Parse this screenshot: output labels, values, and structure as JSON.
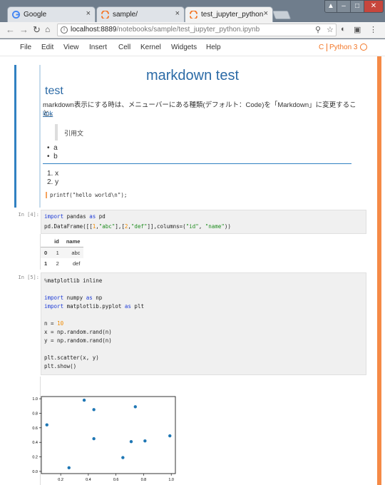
{
  "browser": {
    "tabs": [
      {
        "title": "Google",
        "close": "×"
      },
      {
        "title": "sample/",
        "close": "×"
      },
      {
        "title": "test_jupyter_python",
        "close": "×"
      }
    ],
    "address": {
      "host": "localhost:8889",
      "path": "/notebooks/sample/test_jupyter_python.ipynb"
    }
  },
  "menubar": {
    "items": [
      "File",
      "Edit",
      "View",
      "Insert",
      "Cell",
      "Kernel",
      "Widgets",
      "Help"
    ],
    "kernel_status": "C",
    "kernel_name": "Python 3"
  },
  "markdown": {
    "title": "markdown test",
    "h2": "test",
    "paragraph": "markdown表示にする時は、メニューバーにある種類(デフォルト：Code)を「Markdown」に変更すること。",
    "link": "link",
    "quote": "引用文",
    "bullets": [
      "a",
      "b"
    ],
    "ordered": [
      "x",
      "y"
    ],
    "code": "printf(\"hello world\\n\");"
  },
  "cell1": {
    "prompt": "In [4]:",
    "lines": [
      "import pandas as pd",
      "pd.DataFrame([[1,\"abc\"],[2,\"def\"]],columns=(\"id\", \"name\"))"
    ],
    "table": {
      "columns": [
        "",
        "id",
        "name"
      ],
      "rows": [
        [
          "0",
          "1",
          "abc"
        ],
        [
          "1",
          "2",
          "def"
        ]
      ]
    }
  },
  "cell2": {
    "prompt": "In [5]:",
    "lines": [
      "%matplotlib inline",
      "",
      "import numpy as np",
      "import matplotlib.pyplot as plt",
      "",
      "n = 10",
      "x = np.random.rand(n)",
      "y = np.random.rand(n)",
      "",
      "plt.scatter(x, y)",
      "plt.show()"
    ]
  },
  "chart_data": {
    "type": "scatter",
    "x": [
      0.1,
      0.26,
      0.37,
      0.44,
      0.44,
      0.65,
      0.71,
      0.74,
      0.81,
      0.99
    ],
    "y": [
      0.64,
      0.05,
      0.98,
      0.85,
      0.45,
      0.19,
      0.41,
      0.89,
      0.42,
      0.49
    ],
    "xticks": [
      "0.2",
      "0.4",
      "0.6",
      "0.8",
      "1.0"
    ],
    "yticks": [
      "0.0",
      "0.2",
      "0.4",
      "0.6",
      "0.8",
      "1.0"
    ],
    "xlim": [
      0.06,
      1.03
    ],
    "ylim": [
      -0.03,
      1.03
    ],
    "color": "#1f77b4"
  }
}
